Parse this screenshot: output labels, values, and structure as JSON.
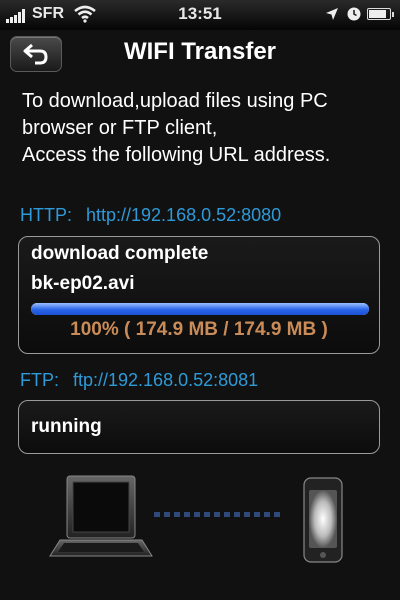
{
  "status_bar": {
    "carrier": "SFR",
    "time": "13:51"
  },
  "nav": {
    "title": "WIFI Transfer"
  },
  "description": [
    "To download,upload files using PC",
    "browser or FTP client,",
    "Access the following URL address."
  ],
  "http": {
    "label": "HTTP:",
    "url": "http://192.168.0.52:8080"
  },
  "transfer": {
    "status": "download complete",
    "filename": "bk-ep02.avi",
    "progress_fraction": 1.0,
    "progress_text": "100% ( 174.9 MB / 174.9 MB )"
  },
  "ftp": {
    "label": "FTP:",
    "url": "ftp://192.168.0.52:8081",
    "status": "running"
  },
  "colors": {
    "link": "#2e9ad8",
    "progress_text": "#c98c58",
    "progress_fill": "#2a66e8"
  },
  "icons": [
    "signal-icon",
    "wifi-icon",
    "location-icon",
    "alarm-icon",
    "battery-icon",
    "back-arrow-icon",
    "laptop-icon",
    "phone-icon"
  ]
}
